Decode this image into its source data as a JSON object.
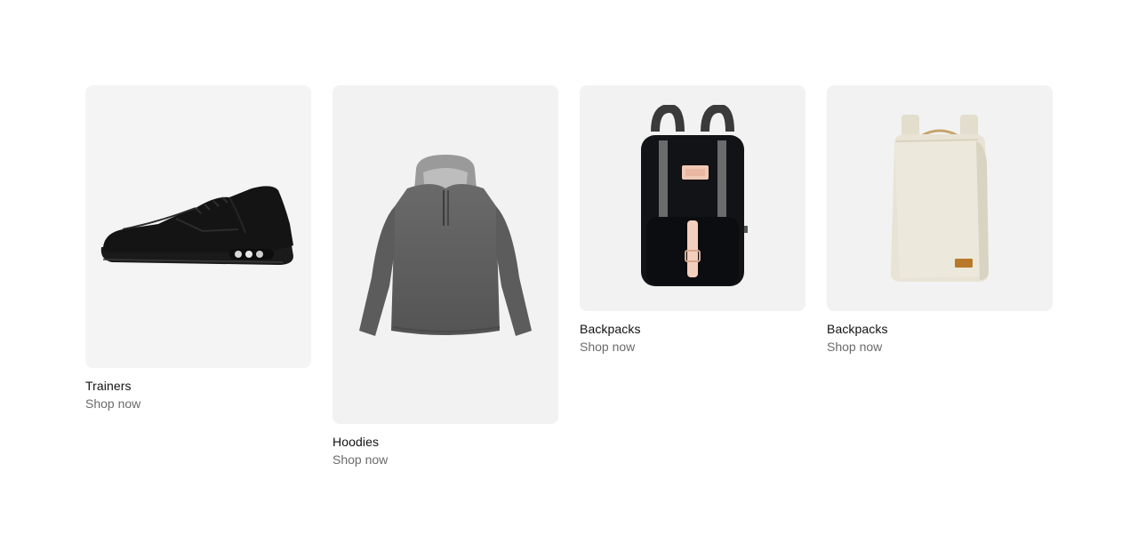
{
  "products": [
    {
      "title": "Trainers",
      "cta": "Shop now",
      "image_icon": "trainer-shoe-icon"
    },
    {
      "title": "Hoodies",
      "cta": "Shop now",
      "image_icon": "hoodie-icon"
    },
    {
      "title": "Backpacks",
      "cta": "Shop now",
      "image_icon": "black-backpack-icon"
    },
    {
      "title": "Backpacks",
      "cta": "Shop now",
      "image_icon": "beige-backpack-icon"
    }
  ],
  "colors": {
    "card_background": "#f3f3f3",
    "title_text": "#111111",
    "cta_text": "#6b6b6b"
  }
}
